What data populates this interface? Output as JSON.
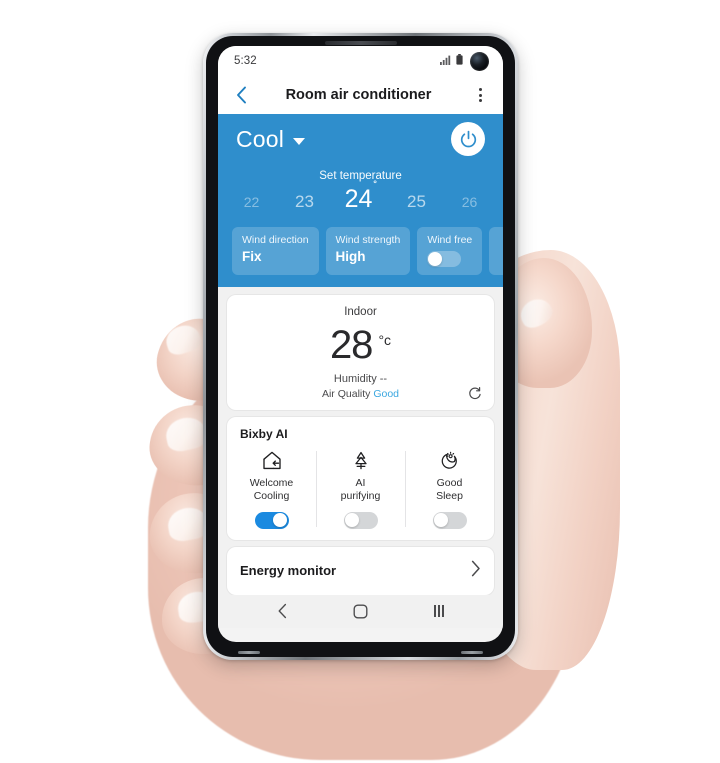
{
  "statusbar": {
    "time": "5:32",
    "signal_icon": "signal-bars-icon",
    "battery_icon": "battery-icon",
    "camera_icon": "front-camera-punch-hole"
  },
  "titlebar": {
    "back_icon": "back-chevron-icon",
    "title": "Room air conditioner",
    "menu_icon": "more-options-icon"
  },
  "control_panel": {
    "mode": "Cool",
    "mode_caret_icon": "chevron-down-icon",
    "power_icon": "power-icon",
    "set_temperature_label": "Set temperature",
    "temperatures": [
      "22",
      "23",
      "24",
      "25",
      "26"
    ],
    "selected_temperature": "24",
    "degree_symbol": "˚",
    "accent_color": "#2f8ecc",
    "chips": [
      {
        "label": "Wind direction",
        "value": "Fix",
        "type": "value"
      },
      {
        "label": "Wind strength",
        "value": "High",
        "type": "value"
      },
      {
        "label": "Wind free",
        "value": "",
        "type": "toggle",
        "on": false
      }
    ]
  },
  "indoor": {
    "title": "Indoor",
    "temperature": "28",
    "unit": "°c",
    "humidity": "Humidity --",
    "air_quality_label": "Air Quality",
    "air_quality_value": "Good",
    "air_quality_color": "#3ba7e0",
    "refresh_icon": "refresh-icon"
  },
  "bixby": {
    "title": "Bixby AI",
    "items": [
      {
        "icon": "home-arrow-icon",
        "label_line1": "Welcome",
        "label_line2": "Cooling",
        "on": true
      },
      {
        "icon": "tree-purify-icon",
        "label_line1": "AI",
        "label_line2": "purifying",
        "on": false
      },
      {
        "icon": "moon-sleep-icon",
        "label_line1": "Good",
        "label_line2": "Sleep",
        "on": false
      }
    ]
  },
  "energy": {
    "label": "Energy monitor",
    "chevron_icon": "chevron-right-icon"
  },
  "navbar": {
    "back_icon": "nav-back-icon",
    "home_icon": "nav-home-icon",
    "recents_icon": "nav-recents-icon"
  }
}
